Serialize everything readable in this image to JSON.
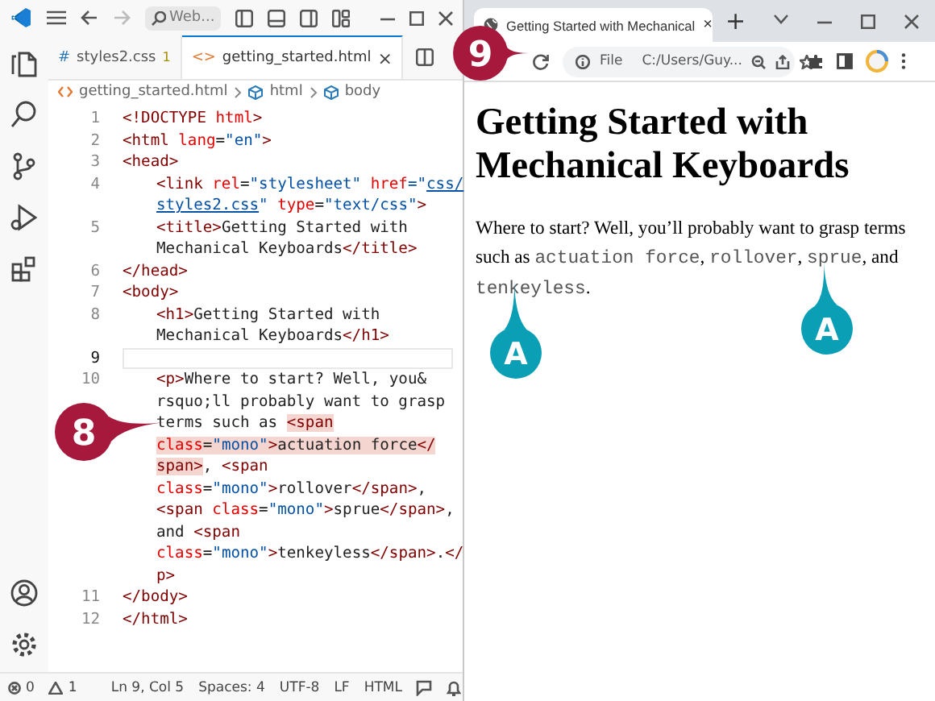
{
  "editor": {
    "title_bar": {
      "search_placeholder": "Web..."
    },
    "tabs": [
      {
        "label": "styles2.css",
        "icon": "#",
        "problems": "1",
        "selected": false
      },
      {
        "label": "getting_started.html",
        "icon": "<>",
        "close": "×",
        "selected": true
      }
    ],
    "breadcrumb": [
      "getting_started.html",
      "html",
      "body"
    ],
    "rows": [
      {
        "number": "1",
        "indented": false,
        "current": false,
        "tokens": [
          {
            "t": "<!DOCTYPE ",
            "kind": "tag",
            "highlighted": false
          },
          {
            "t": "html",
            "kind": "attr",
            "highlighted": false
          },
          {
            "t": ">",
            "kind": "tag",
            "highlighted": false
          }
        ]
      },
      {
        "number": "2",
        "indented": false,
        "current": false,
        "tokens": [
          {
            "t": "<html ",
            "kind": "tag",
            "highlighted": false
          },
          {
            "t": "lang",
            "kind": "attr",
            "highlighted": false
          },
          {
            "t": "=",
            "kind": "text",
            "highlighted": false
          },
          {
            "t": "\"en\"",
            "kind": "str",
            "highlighted": false
          },
          {
            "t": ">",
            "kind": "tag",
            "highlighted": false
          }
        ]
      },
      {
        "number": "3",
        "indented": false,
        "current": false,
        "tokens": [
          {
            "t": "<head>",
            "kind": "tag",
            "highlighted": false
          }
        ]
      },
      {
        "number": "4",
        "indented": true,
        "current": false,
        "tokens": [
          {
            "t": "<link ",
            "kind": "tag",
            "highlighted": false
          },
          {
            "t": "rel",
            "kind": "attr",
            "highlighted": false
          },
          {
            "t": "=",
            "kind": "text",
            "highlighted": false
          },
          {
            "t": "\"stylesheet\" ",
            "kind": "str",
            "highlighted": false
          },
          {
            "t": "href",
            "kind": "attr",
            "highlighted": false
          },
          {
            "t": "=\"",
            "kind": "str",
            "highlighted": false
          },
          {
            "t": "css/",
            "kind": "link",
            "highlighted": false
          }
        ]
      },
      {
        "indented": true,
        "current": false,
        "tokens": [
          {
            "t": "styles2.css",
            "kind": "link",
            "highlighted": false
          },
          {
            "t": "\" ",
            "kind": "str",
            "highlighted": false
          },
          {
            "t": "type",
            "kind": "attr",
            "highlighted": false
          },
          {
            "t": "=",
            "kind": "text",
            "highlighted": false
          },
          {
            "t": "\"text/css\"",
            "kind": "str",
            "highlighted": false
          },
          {
            "t": ">",
            "kind": "tag",
            "highlighted": false
          }
        ]
      },
      {
        "number": "5",
        "indented": true,
        "current": false,
        "tokens": [
          {
            "t": "<title>",
            "kind": "tag",
            "highlighted": false
          },
          {
            "t": "Getting Started with",
            "kind": "text",
            "highlighted": false
          }
        ]
      },
      {
        "indented": true,
        "current": false,
        "tokens": [
          {
            "t": "Mechanical Keyboards",
            "kind": "text",
            "highlighted": false
          },
          {
            "t": "</title>",
            "kind": "tag",
            "highlighted": false
          }
        ]
      },
      {
        "number": "6",
        "indented": false,
        "current": false,
        "tokens": [
          {
            "t": "</head>",
            "kind": "tag",
            "highlighted": false
          }
        ]
      },
      {
        "number": "7",
        "indented": false,
        "current": false,
        "tokens": [
          {
            "t": "<body>",
            "kind": "tag",
            "highlighted": false
          }
        ]
      },
      {
        "number": "8",
        "indented": true,
        "current": false,
        "tokens": [
          {
            "t": "<h1>",
            "kind": "tag",
            "highlighted": false
          },
          {
            "t": "Getting Started with",
            "kind": "text",
            "highlighted": false
          }
        ]
      },
      {
        "indented": true,
        "current": false,
        "tokens": [
          {
            "t": "Mechanical Keyboards",
            "kind": "text",
            "highlighted": false
          },
          {
            "t": "</h1>",
            "kind": "tag",
            "highlighted": false
          }
        ]
      },
      {
        "number": "9",
        "indented": true,
        "current": true,
        "tokens": []
      },
      {
        "number": "10",
        "indented": true,
        "current": false,
        "tokens": [
          {
            "t": "<p>",
            "kind": "tag",
            "highlighted": false
          },
          {
            "t": "Where to start? Well, you&",
            "kind": "text",
            "highlighted": false
          }
        ]
      },
      {
        "indented": true,
        "current": false,
        "tokens": [
          {
            "t": "rsquo;ll probably want to grasp",
            "kind": "text",
            "highlighted": false
          }
        ]
      },
      {
        "indented": true,
        "current": false,
        "tokens": [
          {
            "t": "terms such as ",
            "kind": "text",
            "highlighted": false
          },
          {
            "t": "<span",
            "kind": "tag",
            "highlighted": true
          }
        ]
      },
      {
        "indented": true,
        "current": false,
        "tokens": [
          {
            "t": "class",
            "kind": "attr",
            "highlighted": true
          },
          {
            "t": "=",
            "kind": "text",
            "highlighted": true
          },
          {
            "t": "\"mono\"",
            "kind": "str",
            "highlighted": true
          },
          {
            "t": ">",
            "kind": "tag",
            "highlighted": true
          },
          {
            "t": "actuation force",
            "kind": "text",
            "highlighted": true
          },
          {
            "t": "</",
            "kind": "tag",
            "highlighted": true
          }
        ]
      },
      {
        "indented": true,
        "current": false,
        "tokens": [
          {
            "t": "span>",
            "kind": "tag",
            "highlighted": true
          },
          {
            "t": ", ",
            "kind": "text",
            "highlighted": false
          },
          {
            "t": "<span",
            "kind": "tag",
            "highlighted": false
          }
        ]
      },
      {
        "indented": true,
        "current": false,
        "tokens": [
          {
            "t": "class",
            "kind": "attr",
            "highlighted": false
          },
          {
            "t": "=",
            "kind": "text",
            "highlighted": false
          },
          {
            "t": "\"mono\"",
            "kind": "str",
            "highlighted": false
          },
          {
            "t": ">",
            "kind": "tag",
            "highlighted": false
          },
          {
            "t": "rollover",
            "kind": "text",
            "highlighted": false
          },
          {
            "t": "</span>",
            "kind": "tag",
            "highlighted": false
          },
          {
            "t": ",",
            "kind": "text",
            "highlighted": false
          }
        ]
      },
      {
        "indented": true,
        "current": false,
        "tokens": [
          {
            "t": "<span ",
            "kind": "tag",
            "highlighted": false
          },
          {
            "t": "class",
            "kind": "attr",
            "highlighted": false
          },
          {
            "t": "=",
            "kind": "text",
            "highlighted": false
          },
          {
            "t": "\"mono\"",
            "kind": "str",
            "highlighted": false
          },
          {
            "t": ">",
            "kind": "tag",
            "highlighted": false
          },
          {
            "t": "sprue",
            "kind": "text",
            "highlighted": false
          },
          {
            "t": "</span>",
            "kind": "tag",
            "highlighted": false
          },
          {
            "t": ",",
            "kind": "text",
            "highlighted": false
          }
        ]
      },
      {
        "indented": true,
        "current": false,
        "tokens": [
          {
            "t": "and ",
            "kind": "text",
            "highlighted": false
          },
          {
            "t": "<span",
            "kind": "tag",
            "highlighted": false
          }
        ]
      },
      {
        "indented": true,
        "current": false,
        "tokens": [
          {
            "t": "class",
            "kind": "attr",
            "highlighted": false
          },
          {
            "t": "=",
            "kind": "text",
            "highlighted": false
          },
          {
            "t": "\"mono\"",
            "kind": "str",
            "highlighted": false
          },
          {
            "t": ">",
            "kind": "tag",
            "highlighted": false
          },
          {
            "t": "tenkeyless",
            "kind": "text",
            "highlighted": false
          },
          {
            "t": "</span>",
            "kind": "tag",
            "highlighted": false
          },
          {
            "t": ".",
            "kind": "text",
            "highlighted": false
          },
          {
            "t": "</",
            "kind": "tag",
            "highlighted": false
          }
        ]
      },
      {
        "indented": true,
        "current": false,
        "tokens": [
          {
            "t": "p>",
            "kind": "tag",
            "highlighted": false
          }
        ]
      },
      {
        "number": "11",
        "indented": false,
        "current": false,
        "tokens": [
          {
            "t": "</body>",
            "kind": "tag",
            "highlighted": false
          }
        ]
      },
      {
        "number": "12",
        "indented": false,
        "current": false,
        "tokens": [
          {
            "t": "</html>",
            "kind": "tag",
            "highlighted": false
          }
        ]
      }
    ],
    "status_bar": {
      "errors": "0",
      "warnings": "1",
      "items": [
        "Ln 9, Col 5",
        "Spaces: 4",
        "UTF-8",
        "LF",
        "HTML"
      ]
    }
  },
  "browser": {
    "tab": {
      "title": "Getting Started with Mechanical",
      "close": "×"
    },
    "new_tab": "+",
    "address": {
      "scheme": "File",
      "url": "C:/Users/Guy..."
    },
    "page": {
      "heading": "Getting Started with Mechanical Keyboards",
      "paragraph": [
        {
          "text": "Where to start? Well, you’ll probably want to grasp terms such as ",
          "mono": false
        },
        {
          "text": "actuation force",
          "mono": true
        },
        {
          "text": ", ",
          "mono": false
        },
        {
          "text": "rollover",
          "mono": true
        },
        {
          "text": ", ",
          "mono": false
        },
        {
          "text": "sprue",
          "mono": true
        },
        {
          "text": ", and ",
          "mono": false
        },
        {
          "text": "tenkeyless",
          "mono": true
        },
        {
          "text": ".",
          "mono": false
        }
      ]
    }
  },
  "callouts": [
    {
      "label": "9",
      "color": "#a6193c"
    },
    {
      "label": "8",
      "color": "#a6193c"
    },
    {
      "label": "A",
      "color": "#0b9fb6"
    },
    {
      "label": "A",
      "color": "#0b9fb6"
    }
  ]
}
